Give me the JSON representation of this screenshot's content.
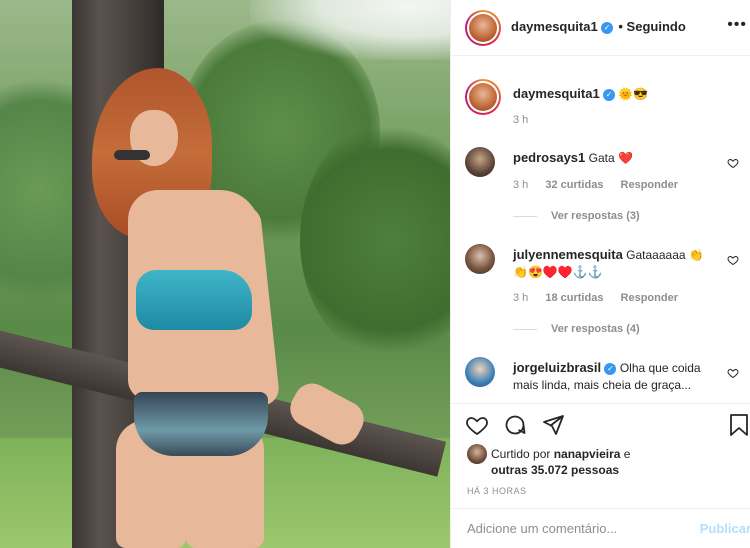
{
  "post": {
    "author": "daymesquita1",
    "follow_status": "• Seguindo",
    "caption_emoji": "🌞😎",
    "caption_time": "3 h"
  },
  "comments": [
    {
      "user": "pedrosays1",
      "text": "Gata ❤️",
      "time": "3 h",
      "likes": "32 curtidas",
      "reply": "Responder",
      "view_replies": "Ver respostas (3)"
    },
    {
      "user": "julyennemesquita",
      "text": "Gataaaaaa 👏",
      "text2": "👏😍♥️♥️⚓⚓",
      "time": "3 h",
      "likes": "18 curtidas",
      "reply": "Responder",
      "view_replies": "Ver respostas (4)"
    },
    {
      "user": "jorgeluizbrasil",
      "text": "Olha que coida",
      "text2": "mais linda, mais cheia de graça...",
      "verified": true
    }
  ],
  "likes": {
    "prefix": "Curtido por",
    "user": "nanapvieira",
    "suffix": "e",
    "others": "outras 35.072 pessoas"
  },
  "timestamp": "HÁ 3 HORAS",
  "add_comment": {
    "placeholder": "Adicione um comentário...",
    "post_label": "Publicar"
  },
  "icons": [
    "heart-icon",
    "comment-icon",
    "share-icon",
    "bookmark-icon",
    "more-options-icon",
    "verified-icon"
  ],
  "colors": {
    "accent": "#3897f0",
    "post_disabled": "#b2dffc",
    "muted": "#8e8e8e",
    "heart_red": "#ed4956"
  }
}
